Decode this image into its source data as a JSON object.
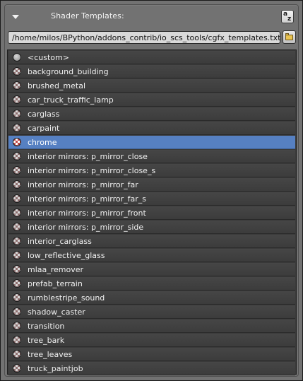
{
  "panel": {
    "title": "Shader Templates:",
    "collapse_icon": "triangle-down-icon",
    "sort_icon": "sort-alpha-icon",
    "sort_a": "a",
    "sort_z": "z"
  },
  "path": {
    "value": "/home/milos/BPython/addons_contrib/io_scs_tools/cgfx_templates.txt",
    "browse_icon": "folder-icon"
  },
  "list": {
    "selected_index": 6,
    "items": [
      {
        "label": "<custom>",
        "icon": "sphere-icon"
      },
      {
        "label": "background_building",
        "icon": "material-checker-icon"
      },
      {
        "label": "brushed_metal",
        "icon": "material-checker-icon"
      },
      {
        "label": "car_truck_traffic_lamp",
        "icon": "material-checker-icon"
      },
      {
        "label": "carglass",
        "icon": "material-checker-icon"
      },
      {
        "label": "carpaint",
        "icon": "material-checker-icon"
      },
      {
        "label": "chrome",
        "icon": "material-checker-icon"
      },
      {
        "label": "interior mirrors: p_mirror_close",
        "icon": "material-checker-icon"
      },
      {
        "label": "interior mirrors: p_mirror_close_s",
        "icon": "material-checker-icon"
      },
      {
        "label": "interior mirrors: p_mirror_far",
        "icon": "material-checker-icon"
      },
      {
        "label": "interior mirrors: p_mirror_far_s",
        "icon": "material-checker-icon"
      },
      {
        "label": "interior mirrors: p_mirror_front",
        "icon": "material-checker-icon"
      },
      {
        "label": "interior mirrors: p_mirror_side",
        "icon": "material-checker-icon"
      },
      {
        "label": "interior_carglass",
        "icon": "material-checker-icon"
      },
      {
        "label": "low_reflective_glass",
        "icon": "material-checker-icon"
      },
      {
        "label": "mlaa_remover",
        "icon": "material-checker-icon"
      },
      {
        "label": "prefab_terrain",
        "icon": "material-checker-icon"
      },
      {
        "label": "rumblestripe_sound",
        "icon": "material-checker-icon"
      },
      {
        "label": "shadow_caster",
        "icon": "material-checker-icon"
      },
      {
        "label": "transition",
        "icon": "material-checker-icon"
      },
      {
        "label": "tree_bark",
        "icon": "material-checker-icon"
      },
      {
        "label": "tree_leaves",
        "icon": "material-checker-icon"
      },
      {
        "label": "truck_paintjob",
        "icon": "material-checker-icon"
      }
    ]
  },
  "colors": {
    "panel_bg": "#727272",
    "row_bg": "#424242",
    "selected_bg": "#5680c2",
    "text": "#f0f0f0"
  }
}
